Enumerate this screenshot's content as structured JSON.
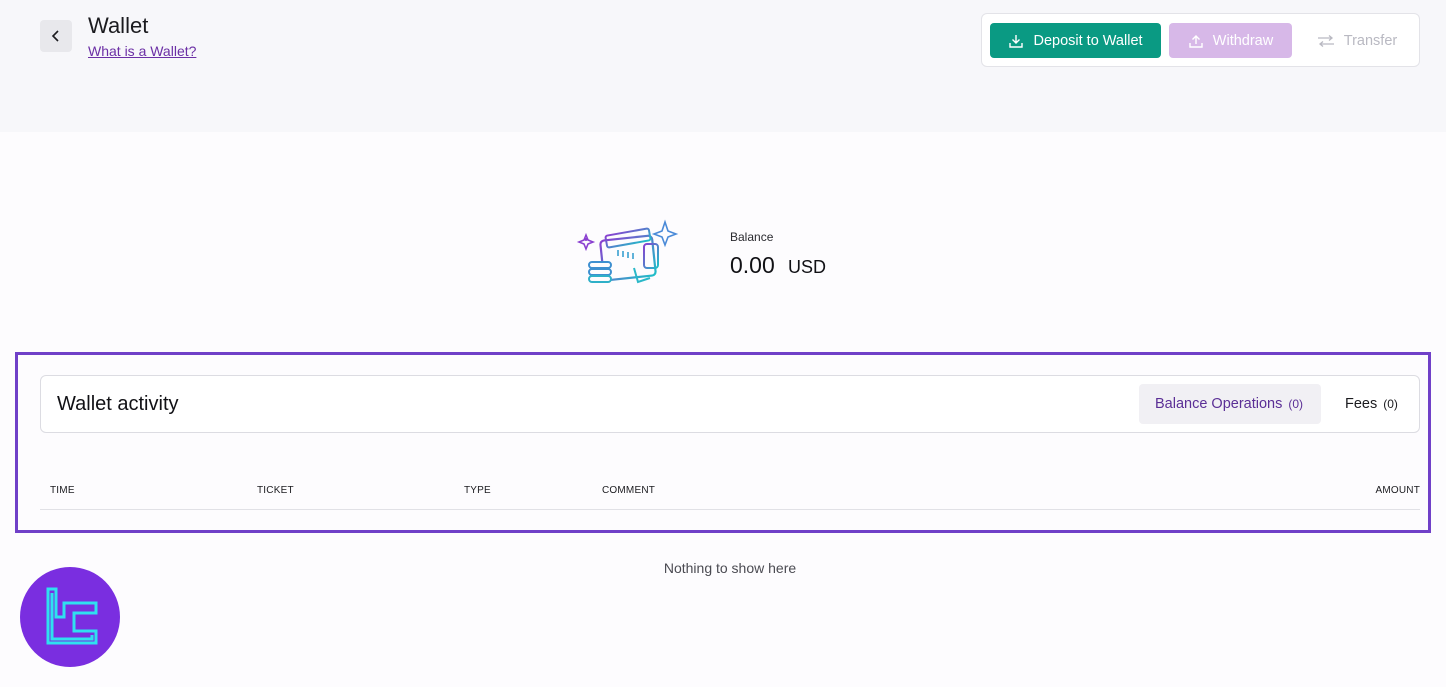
{
  "header": {
    "title": "Wallet",
    "help_link": "What is a Wallet?",
    "back_icon": "chevron-left-icon"
  },
  "actions": {
    "deposit_label": "Deposit to Wallet",
    "withdraw_label": "Withdraw",
    "transfer_label": "Transfer"
  },
  "balance": {
    "label": "Balance",
    "amount": "0.00",
    "currency": "USD"
  },
  "activity": {
    "title": "Wallet activity",
    "tabs": [
      {
        "label": "Balance Operations",
        "count": "(0)",
        "active": true
      },
      {
        "label": "Fees",
        "count": "(0)",
        "active": false
      }
    ],
    "columns": [
      "TIME",
      "TICKET",
      "TYPE",
      "COMMENT",
      "AMOUNT"
    ],
    "empty_message": "Nothing to show here"
  },
  "colors": {
    "primary": "#0a9a83",
    "withdraw_disabled": "#d7b8e8",
    "accent_purple": "#6b2fa5",
    "highlight": "#7040c8"
  }
}
